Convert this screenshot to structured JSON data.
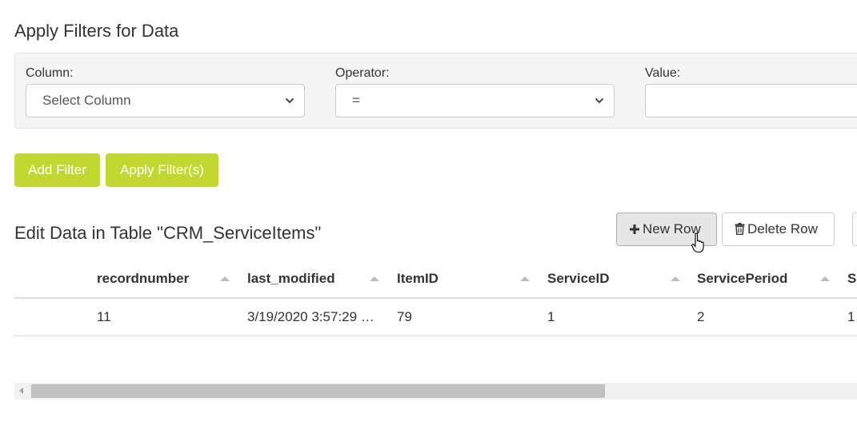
{
  "filters": {
    "title": "Apply Filters for Data",
    "column_label": "Column:",
    "column_value": "Select Column",
    "operator_label": "Operator:",
    "operator_value": "=",
    "value_label": "Value:",
    "value_text": ""
  },
  "buttons": {
    "add_filter": "Add Filter",
    "apply_filters": "Apply Filter(s)",
    "new_row": "New Row",
    "delete_row": "Delete Row"
  },
  "table": {
    "title": "Edit Data in Table \"CRM_ServiceItems\"",
    "columns": [
      "recordnumber",
      "last_modified",
      "ItemID",
      "ServiceID",
      "ServicePeriod",
      "S"
    ],
    "rows": [
      [
        "11",
        "3/19/2020 3:57:29 …",
        "79",
        "1",
        "2",
        "1"
      ]
    ]
  },
  "colors": {
    "accent_green": "#c2d730",
    "panel_bg": "#f5f5f5"
  },
  "icons": {
    "plus": "plus-icon",
    "trash": "trash-icon",
    "chevron": "chevron-down-icon",
    "sort": "sort-asc-icon"
  }
}
